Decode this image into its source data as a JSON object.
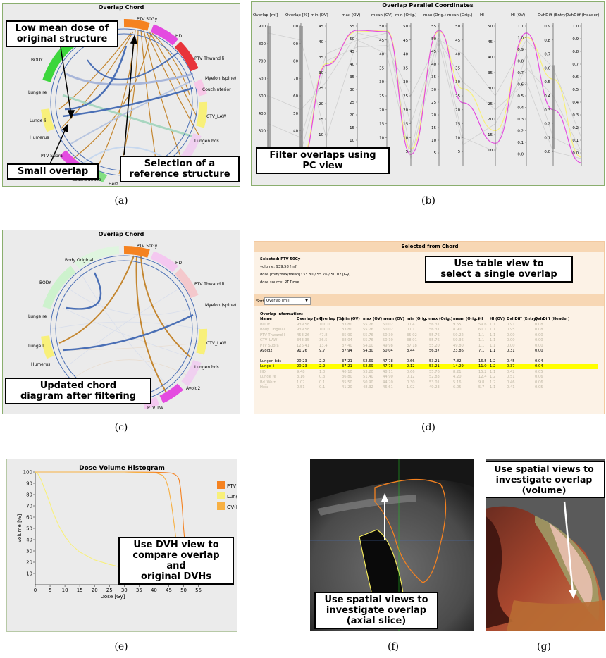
{
  "labels": {
    "a": "(a)",
    "b": "(b)",
    "c": "(c)",
    "d": "(d)",
    "e": "(e)",
    "f": "(f)",
    "g": "(g)"
  },
  "colors": {
    "orange": "#f58220",
    "magenta": "#e44be0",
    "red": "#e8343a",
    "green": "#3cd63c",
    "yellow": "#f8f07a",
    "blue": "#4a6fb5",
    "tan": "#f7e4cf",
    "highlight": "#ffff00"
  },
  "panel_a": {
    "title": "Overlap Chord",
    "structures": [
      "PTV 50Gy",
      "HD",
      "PTV Thwand li",
      "Myelon (spine)",
      "CouchInterior",
      "CTV_LAW",
      "Lungen bds",
      "Herz",
      "CouchSurface",
      "PTV Supra",
      "Humerus",
      "Lunge li",
      "Lunge re",
      "BODY"
    ],
    "callouts": {
      "low_mean": "Low mean dose of\noriginal structure",
      "small": "Small overlap",
      "selection": "Selection of a\nreference structure"
    }
  },
  "panel_b": {
    "title": "Overlap Parallel Coordinates",
    "axes": [
      "Overlap [ml]",
      "Overlap [%]",
      "min (OV)",
      "max (OV)",
      "mean (OV)",
      "min (Orig.)",
      "max (Orig.)",
      "mean (Orig.)",
      "HI",
      "HI (OV)",
      "DvhDiff (Entry)",
      "DvhDiff (Header)"
    ],
    "ticks": [
      [
        "900",
        "800",
        "700",
        "600",
        "500",
        "400",
        "300",
        "200"
      ],
      [
        "100",
        "90",
        "80",
        "70",
        "60",
        "50",
        "40",
        "30"
      ],
      [
        "45",
        "40",
        "35",
        "30",
        "25",
        "20",
        "15",
        "10",
        "5"
      ],
      [
        "55",
        "50",
        "45",
        "40",
        "35",
        "30",
        "25",
        "20",
        "15",
        "10",
        "5"
      ],
      [
        "50",
        "45",
        "40",
        "35",
        "30",
        "25",
        "20",
        "15",
        "10",
        "5"
      ],
      [
        "50",
        "45",
        "40",
        "35",
        "30",
        "25",
        "20",
        "15",
        "10",
        "5"
      ],
      [
        "55",
        "50",
        "45",
        "40",
        "35",
        "30",
        "25",
        "20",
        "15",
        "10",
        "5"
      ],
      [
        "50",
        "45",
        "40",
        "35",
        "30",
        "25",
        "20",
        "15",
        "10",
        "5"
      ],
      [
        "50",
        "45",
        "40",
        "35",
        "30",
        "25",
        "20",
        "15",
        "10"
      ],
      [
        "1.1",
        "1.0",
        "0.9",
        "0.8",
        "0.7",
        "0.6",
        "0.5",
        "0.4",
        "0.3",
        "0.2",
        "0.1",
        "0.0"
      ],
      [
        "0.9",
        "0.8",
        "0.7",
        "0.6",
        "0.5",
        "0.4",
        "0.3",
        "0.2",
        "0.1",
        "0.0"
      ],
      [
        "1.0",
        "0.9",
        "0.8",
        "0.7",
        "0.6",
        "0.5",
        "0.4",
        "0.3",
        "0.2",
        "0.1",
        "0.0"
      ]
    ],
    "callout": "Filter overlaps using\nPC view"
  },
  "panel_c": {
    "title": "Overlap Chord",
    "structures": [
      "PTV 50Gy",
      "Body Original",
      "HD",
      "BODY",
      "PTV Thwand li",
      "Myelon (spine)",
      "Lunge re",
      "Lunge li",
      "CTV_LAW",
      "Humerus",
      "Lungen bds",
      "Avoid2",
      "PTV TW"
    ],
    "callout": "Updated chord\ndiagram after filtering"
  },
  "panel_d": {
    "title": "Selected from Chord",
    "selected": "Selected: PTV 50Gy",
    "volume": "volume: 939.58 [ml]",
    "dose": "dose [min/max/mean]: 33.80 / 55.76 / 50.02 [Gy]",
    "source": "dose source: RT Dose",
    "sort_label": "Sort:",
    "sort_value": "Overlap [ml]",
    "info_label": "Overlap information:",
    "callout": "Use table view to\nselect a single overlap",
    "columns": [
      "Name",
      "Overlap [ml]",
      "Overlap [%]",
      "min (OV)",
      "max (OV)",
      "mean (OV)",
      "min (Orig.)",
      "max (Orig.)",
      "mean (Orig.)",
      "HI",
      "HI (OV)",
      "DvhDiff (Entry)",
      "DvhDiff (Header)"
    ],
    "rows_dim_top": [
      [
        "BODY",
        "939.58",
        "100.0",
        "33.80",
        "55.76",
        "50.02",
        "0.04",
        "56.37",
        "9.55",
        "59.6",
        "1.1",
        "0.91",
        "0.08"
      ],
      [
        "Body Original",
        "939.58",
        "100.0",
        "33.80",
        "55.76",
        "50.02",
        "0.01",
        "56.37",
        "8.90",
        "60.1",
        "1.1",
        "0.95",
        "0.08"
      ],
      [
        "PTV Thwand li",
        "453.26",
        "47.8",
        "35.90",
        "55.76",
        "50.30",
        "35.02",
        "55.76",
        "50.22",
        "1.1",
        "1.1",
        "0.00",
        "0.00"
      ],
      [
        "CTV_LAW",
        "343.35",
        "36.5",
        "38.04",
        "55.76",
        "50.10",
        "38.01",
        "55.76",
        "50.36",
        "1.1",
        "1.1",
        "0.00",
        "0.00"
      ],
      [
        "PTV Supra",
        "126.41",
        "13.4",
        "37.40",
        "54.10",
        "49.98",
        "37.18",
        "55.20",
        "49.80",
        "1.1",
        "1.1",
        "0.00",
        "0.00"
      ]
    ],
    "row_avoid": [
      "Avoid2",
      "91.26",
      "9.7",
      "37.94",
      "54.30",
      "50.04",
      "3.44",
      "56.37",
      "23.86",
      "7.1",
      "1.1",
      "0.31",
      "0.00"
    ],
    "row_lungen": [
      "Lungen bds",
      "20.23",
      "2.2",
      "37.21",
      "52.69",
      "47.78",
      "0.66",
      "53.21",
      "7.82",
      "16.5",
      "1.2",
      "0.45",
      "0.04"
    ],
    "row_lunge": [
      "Lunge li",
      "20.23",
      "2.2",
      "37.21",
      "52.69",
      "47.78",
      "2.12",
      "53.21",
      "14.29",
      "11.0",
      "1.2",
      "0.37",
      "0.04"
    ],
    "rows_dim_bottom": [
      [
        "HD",
        "9.48",
        "1.0",
        "40.10",
        "53.20",
        "48.11",
        "0.66",
        "55.76",
        "8.21",
        "15.2",
        "1.1",
        "0.42",
        "0.05"
      ],
      [
        "Lunge re",
        "3.16",
        "0.3",
        "36.80",
        "51.40",
        "44.90",
        "0.12",
        "52.83",
        "4.20",
        "12.4",
        "1.2",
        "0.51",
        "0.06"
      ],
      [
        "Bd_Wern",
        "1.02",
        "0.1",
        "35.50",
        "50.90",
        "44.20",
        "0.30",
        "53.01",
        "5.16",
        "9.8",
        "1.2",
        "0.46",
        "0.06"
      ],
      [
        "Herz",
        "0.51",
        "0.1",
        "41.20",
        "48.32",
        "46.61",
        "1.02",
        "49.23",
        "6.05",
        "5.7",
        "1.1",
        "0.41",
        "0.05"
      ]
    ]
  },
  "panel_e": {
    "title": "Dose Volume Histogram",
    "callout": "Use DVH view to\ncompare overlap and\noriginal DVHs"
  },
  "panel_f": {
    "callout": "Use spatial views to\ninvestigate overlap\n(axial slice)"
  },
  "panel_g": {
    "callout": "Use spatial views to\ninvestigate overlap\n(volume)"
  },
  "chart_data": {
    "type": "line",
    "title": "Dose Volume Histogram",
    "xlabel": "Dose [Gy]",
    "ylabel": "Volume [%]",
    "xlim": [
      0,
      57
    ],
    "ylim": [
      0,
      100
    ],
    "xticks": [
      "0",
      "5",
      "10",
      "15",
      "20",
      "25",
      "30",
      "35",
      "40",
      "45",
      "50",
      "55"
    ],
    "yticks": [
      "10",
      "20",
      "30",
      "40",
      "50",
      "60",
      "70",
      "80",
      "90",
      "100"
    ],
    "series": [
      {
        "name": "PTV 50Gy",
        "color": "#f58220",
        "x": [
          0,
          30,
          40,
          44,
          46,
          47,
          48,
          48.5,
          49,
          49.5,
          50,
          51,
          52,
          53,
          55
        ],
        "y": [
          100,
          100,
          99.8,
          99.5,
          99,
          98,
          96,
          93,
          85,
          70,
          50,
          20,
          5,
          1,
          0
        ]
      },
      {
        "name": "Lunge li",
        "color": "#f8f07a",
        "x": [
          0,
          1,
          2,
          3,
          4,
          5,
          6,
          8,
          10,
          12,
          15,
          20,
          25,
          30,
          35,
          40,
          42,
          44,
          46,
          48,
          50,
          52
        ],
        "y": [
          100,
          98,
          93,
          86,
          79,
          72,
          64,
          52,
          43,
          36,
          29,
          22,
          18,
          15,
          13,
          11,
          9,
          7,
          4,
          2,
          1,
          0
        ]
      },
      {
        "name": "OV(PTV 50Gy, Lunge li)",
        "color": "#f7b043",
        "x": [
          0,
          30,
          38,
          41,
          43,
          44,
          45,
          46,
          47,
          48,
          49,
          50,
          51
        ],
        "y": [
          100,
          100,
          99.5,
          99,
          97,
          93,
          85,
          70,
          50,
          28,
          10,
          3,
          0
        ]
      }
    ]
  }
}
